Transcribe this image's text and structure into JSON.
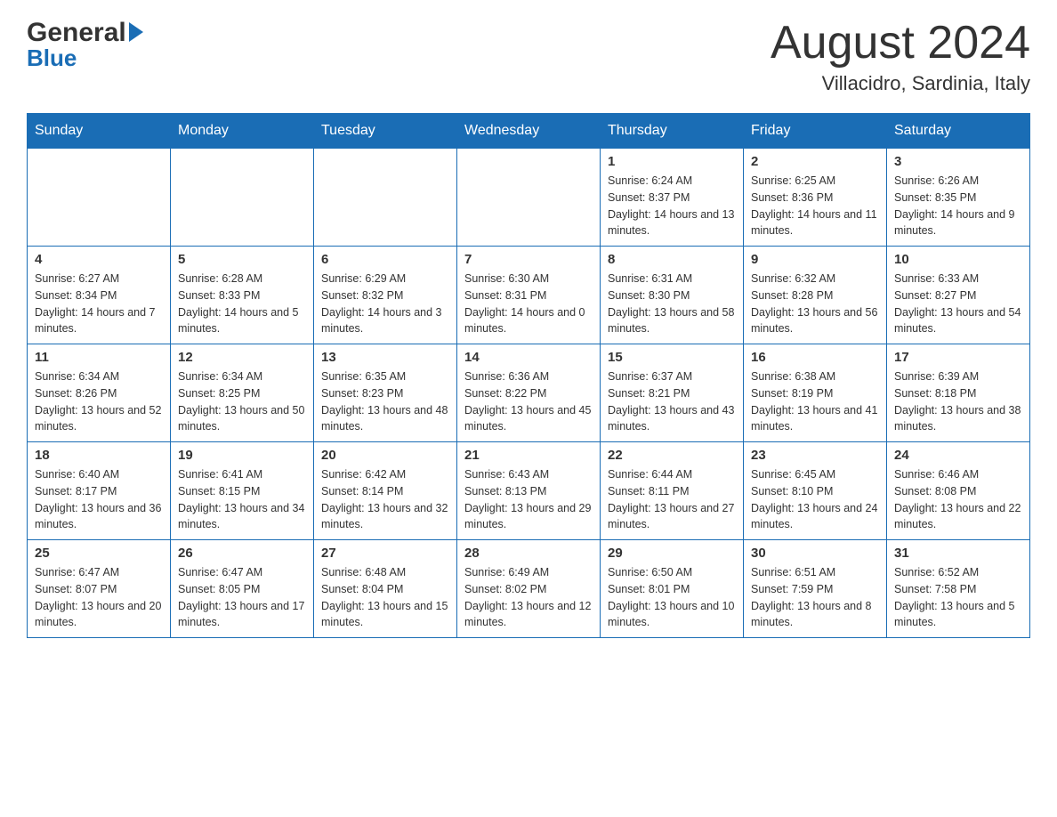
{
  "header": {
    "logo_general": "General",
    "logo_blue": "Blue",
    "title": "August 2024",
    "subtitle": "Villacidro, Sardinia, Italy"
  },
  "days_of_week": [
    "Sunday",
    "Monday",
    "Tuesday",
    "Wednesday",
    "Thursday",
    "Friday",
    "Saturday"
  ],
  "weeks": [
    [
      {
        "day": "",
        "info": ""
      },
      {
        "day": "",
        "info": ""
      },
      {
        "day": "",
        "info": ""
      },
      {
        "day": "",
        "info": ""
      },
      {
        "day": "1",
        "info": "Sunrise: 6:24 AM\nSunset: 8:37 PM\nDaylight: 14 hours and 13 minutes."
      },
      {
        "day": "2",
        "info": "Sunrise: 6:25 AM\nSunset: 8:36 PM\nDaylight: 14 hours and 11 minutes."
      },
      {
        "day": "3",
        "info": "Sunrise: 6:26 AM\nSunset: 8:35 PM\nDaylight: 14 hours and 9 minutes."
      }
    ],
    [
      {
        "day": "4",
        "info": "Sunrise: 6:27 AM\nSunset: 8:34 PM\nDaylight: 14 hours and 7 minutes."
      },
      {
        "day": "5",
        "info": "Sunrise: 6:28 AM\nSunset: 8:33 PM\nDaylight: 14 hours and 5 minutes."
      },
      {
        "day": "6",
        "info": "Sunrise: 6:29 AM\nSunset: 8:32 PM\nDaylight: 14 hours and 3 minutes."
      },
      {
        "day": "7",
        "info": "Sunrise: 6:30 AM\nSunset: 8:31 PM\nDaylight: 14 hours and 0 minutes."
      },
      {
        "day": "8",
        "info": "Sunrise: 6:31 AM\nSunset: 8:30 PM\nDaylight: 13 hours and 58 minutes."
      },
      {
        "day": "9",
        "info": "Sunrise: 6:32 AM\nSunset: 8:28 PM\nDaylight: 13 hours and 56 minutes."
      },
      {
        "day": "10",
        "info": "Sunrise: 6:33 AM\nSunset: 8:27 PM\nDaylight: 13 hours and 54 minutes."
      }
    ],
    [
      {
        "day": "11",
        "info": "Sunrise: 6:34 AM\nSunset: 8:26 PM\nDaylight: 13 hours and 52 minutes."
      },
      {
        "day": "12",
        "info": "Sunrise: 6:34 AM\nSunset: 8:25 PM\nDaylight: 13 hours and 50 minutes."
      },
      {
        "day": "13",
        "info": "Sunrise: 6:35 AM\nSunset: 8:23 PM\nDaylight: 13 hours and 48 minutes."
      },
      {
        "day": "14",
        "info": "Sunrise: 6:36 AM\nSunset: 8:22 PM\nDaylight: 13 hours and 45 minutes."
      },
      {
        "day": "15",
        "info": "Sunrise: 6:37 AM\nSunset: 8:21 PM\nDaylight: 13 hours and 43 minutes."
      },
      {
        "day": "16",
        "info": "Sunrise: 6:38 AM\nSunset: 8:19 PM\nDaylight: 13 hours and 41 minutes."
      },
      {
        "day": "17",
        "info": "Sunrise: 6:39 AM\nSunset: 8:18 PM\nDaylight: 13 hours and 38 minutes."
      }
    ],
    [
      {
        "day": "18",
        "info": "Sunrise: 6:40 AM\nSunset: 8:17 PM\nDaylight: 13 hours and 36 minutes."
      },
      {
        "day": "19",
        "info": "Sunrise: 6:41 AM\nSunset: 8:15 PM\nDaylight: 13 hours and 34 minutes."
      },
      {
        "day": "20",
        "info": "Sunrise: 6:42 AM\nSunset: 8:14 PM\nDaylight: 13 hours and 32 minutes."
      },
      {
        "day": "21",
        "info": "Sunrise: 6:43 AM\nSunset: 8:13 PM\nDaylight: 13 hours and 29 minutes."
      },
      {
        "day": "22",
        "info": "Sunrise: 6:44 AM\nSunset: 8:11 PM\nDaylight: 13 hours and 27 minutes."
      },
      {
        "day": "23",
        "info": "Sunrise: 6:45 AM\nSunset: 8:10 PM\nDaylight: 13 hours and 24 minutes."
      },
      {
        "day": "24",
        "info": "Sunrise: 6:46 AM\nSunset: 8:08 PM\nDaylight: 13 hours and 22 minutes."
      }
    ],
    [
      {
        "day": "25",
        "info": "Sunrise: 6:47 AM\nSunset: 8:07 PM\nDaylight: 13 hours and 20 minutes."
      },
      {
        "day": "26",
        "info": "Sunrise: 6:47 AM\nSunset: 8:05 PM\nDaylight: 13 hours and 17 minutes."
      },
      {
        "day": "27",
        "info": "Sunrise: 6:48 AM\nSunset: 8:04 PM\nDaylight: 13 hours and 15 minutes."
      },
      {
        "day": "28",
        "info": "Sunrise: 6:49 AM\nSunset: 8:02 PM\nDaylight: 13 hours and 12 minutes."
      },
      {
        "day": "29",
        "info": "Sunrise: 6:50 AM\nSunset: 8:01 PM\nDaylight: 13 hours and 10 minutes."
      },
      {
        "day": "30",
        "info": "Sunrise: 6:51 AM\nSunset: 7:59 PM\nDaylight: 13 hours and 8 minutes."
      },
      {
        "day": "31",
        "info": "Sunrise: 6:52 AM\nSunset: 7:58 PM\nDaylight: 13 hours and 5 minutes."
      }
    ]
  ]
}
